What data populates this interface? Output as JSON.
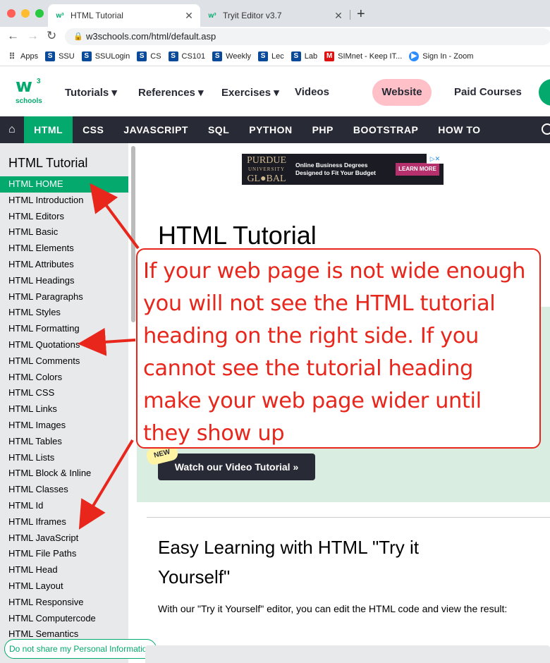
{
  "browser": {
    "tabs": [
      {
        "title": "HTML Tutorial",
        "favicon": "w3-icon",
        "active": true
      },
      {
        "title": "Tryit Editor v3.7",
        "favicon": "w3-icon",
        "active": false
      }
    ],
    "url": "w3schools.com/html/default.asp",
    "bookmarks": [
      {
        "label": "Apps",
        "icon": "apps-grid-icon"
      },
      {
        "label": "SSU",
        "icon": "s-icon"
      },
      {
        "label": "SSULogin",
        "icon": "s-icon"
      },
      {
        "label": "CS",
        "icon": "s-icon"
      },
      {
        "label": "CS101",
        "icon": "s-icon"
      },
      {
        "label": "Weekly",
        "icon": "s-icon"
      },
      {
        "label": "Lec",
        "icon": "s-icon"
      },
      {
        "label": "Lab",
        "icon": "s-icon"
      },
      {
        "label": "SIMnet - Keep IT...",
        "icon": "m-icon"
      },
      {
        "label": "Sign In - Zoom",
        "icon": "zoom-icon"
      }
    ]
  },
  "header": {
    "logo_text": "schools",
    "menu": [
      "Tutorials",
      "References",
      "Exercises",
      "Videos"
    ],
    "website_label": "Website",
    "paid_label": "Paid Courses"
  },
  "topnav": [
    "HTML",
    "CSS",
    "JAVASCRIPT",
    "SQL",
    "PYTHON",
    "PHP",
    "BOOTSTRAP",
    "HOW TO"
  ],
  "sidebar": {
    "title": "HTML Tutorial",
    "items": [
      "HTML HOME",
      "HTML Introduction",
      "HTML Editors",
      "HTML Basic",
      "HTML Elements",
      "HTML Attributes",
      "HTML Headings",
      "HTML Paragraphs",
      "HTML Styles",
      "HTML Formatting",
      "HTML Quotations",
      "HTML Comments",
      "HTML Colors",
      "HTML CSS",
      "HTML Links",
      "HTML Images",
      "HTML Tables",
      "HTML Lists",
      "HTML Block & Inline",
      "HTML Classes",
      "HTML Id",
      "HTML Iframes",
      "HTML JavaScript",
      "HTML File Paths",
      "HTML Head",
      "HTML Layout",
      "HTML Responsive",
      "HTML Computercode",
      "HTML Semantics"
    ],
    "privacy_label": "Do not share my Personal Information"
  },
  "ad": {
    "brand": "PURDUE",
    "brand_sub": "UNIVERSITY",
    "brand_line2": "GL●BAL",
    "text_line1": "Online Business Degrees",
    "text_line2": "Designed to Fit Your Budget",
    "button": "LEARN MORE"
  },
  "main": {
    "heading": "HTML Tutorial",
    "new_label": "NEW",
    "video_button": "Watch our Video Tutorial »",
    "easy_heading": "Easy Learning with HTML \"Try it Yourself\"",
    "easy_text": "With our \"Try it Yourself\" editor, you can edit the HTML code and view the result:"
  },
  "annotation": {
    "text": "If your web page is not wide enough you will not see the HTML tutorial heading on the right side.  If you cannot see the tutorial heading make your web page wider until they show up",
    "color": "#e8261c"
  },
  "colors": {
    "accent": "#04AA6D",
    "dark": "#282A35",
    "sidebar_bg": "#E7E9EB"
  }
}
